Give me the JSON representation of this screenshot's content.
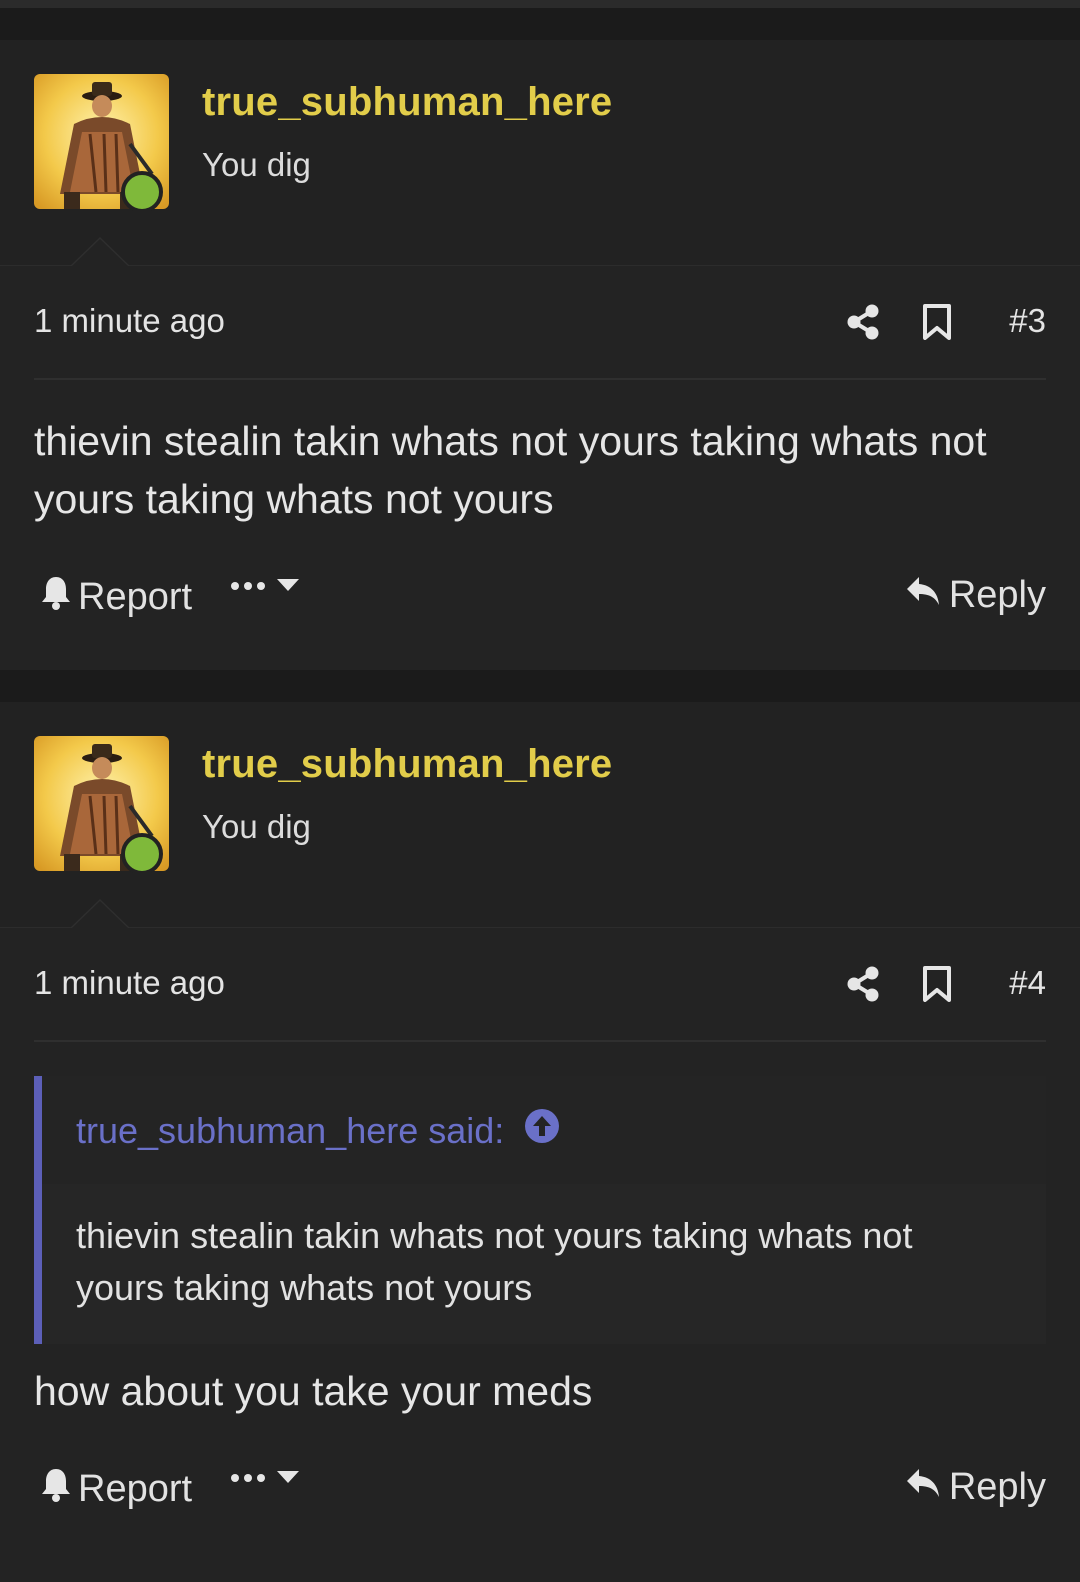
{
  "posts": [
    {
      "username": "true_subhuman_here",
      "user_title": "You dig",
      "time": "1 minute ago",
      "number": "#3",
      "body": "thievin stealin takin whats not yours taking whats not yours taking whats not yours",
      "report_label": "Report",
      "reply_label": "Reply"
    },
    {
      "username": "true_subhuman_here",
      "user_title": "You dig",
      "time": "1 minute ago",
      "number": "#4",
      "quote": {
        "author": "true_subhuman_here said:",
        "text": "thievin stealin takin whats not yours taking whats not yours taking whats not yours"
      },
      "body": "how about you take your meds",
      "report_label": "Report",
      "reply_label": "Reply"
    }
  ],
  "colors": {
    "username": "#e2cd4a",
    "online": "#7fb93a",
    "quote_accent": "#5c5fb8",
    "quote_author": "#6a70c8"
  },
  "icons": [
    "share-icon",
    "bookmark-icon",
    "bell-icon",
    "ellipsis-icon",
    "caret-down-icon",
    "reply-arrow-icon",
    "arrow-up-circle-icon"
  ]
}
